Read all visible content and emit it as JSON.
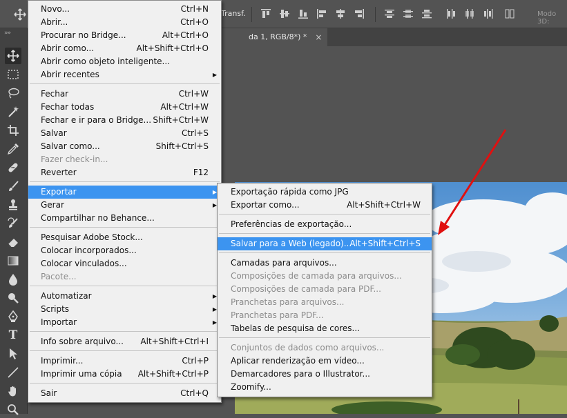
{
  "options_bar": {
    "transform_label": "Transf.",
    "mode_3d_label": "Modo 3D:"
  },
  "document_tab": {
    "title": "da 1, RGB/8*) *",
    "close_symbol": "×"
  },
  "toolbar": {
    "grip": "»»",
    "tools": [
      "move-icon",
      "marquee-icon",
      "lasso-icon",
      "magic-wand-icon",
      "crop-icon",
      "eyedropper-icon",
      "healing-icon",
      "brush-icon",
      "stamp-icon",
      "history-brush-icon",
      "eraser-icon",
      "gradient-icon",
      "blur-icon",
      "dodge-icon",
      "pen-icon",
      "type-icon",
      "path-selection-icon",
      "line-icon",
      "hand-icon",
      "zoom-icon"
    ],
    "type_glyph": "T"
  },
  "file_menu": {
    "items": [
      {
        "label": "Novo...",
        "shortcut": "Ctrl+N"
      },
      {
        "label": "Abrir...",
        "shortcut": "Ctrl+O"
      },
      {
        "label": "Procurar no Bridge...",
        "shortcut": "Alt+Ctrl+O"
      },
      {
        "label": "Abrir como...",
        "shortcut": "Alt+Shift+Ctrl+O"
      },
      {
        "label": "Abrir como objeto inteligente...",
        "shortcut": ""
      },
      {
        "label": "Abrir recentes",
        "submenu": true
      },
      {
        "label": "Fechar",
        "shortcut": "Ctrl+W"
      },
      {
        "label": "Fechar todas",
        "shortcut": "Alt+Ctrl+W"
      },
      {
        "label": "Fechar e ir para o Bridge...",
        "shortcut": "Shift+Ctrl+W"
      },
      {
        "label": "Salvar",
        "shortcut": "Ctrl+S"
      },
      {
        "label": "Salvar como...",
        "shortcut": "Shift+Ctrl+S"
      },
      {
        "label": "Fazer check-in...",
        "disabled": true
      },
      {
        "label": "Reverter",
        "shortcut": "F12"
      },
      {
        "label": "Exportar",
        "submenu": true,
        "highlighted": true
      },
      {
        "label": "Gerar",
        "submenu": true
      },
      {
        "label": "Compartilhar no Behance..."
      },
      {
        "label": "Pesquisar Adobe Stock..."
      },
      {
        "label": "Colocar incorporados..."
      },
      {
        "label": "Colocar vinculados..."
      },
      {
        "label": "Pacote...",
        "disabled": true
      },
      {
        "label": "Automatizar",
        "submenu": true
      },
      {
        "label": "Scripts",
        "submenu": true
      },
      {
        "label": "Importar",
        "submenu": true
      },
      {
        "label": "Info sobre arquivo...",
        "shortcut": "Alt+Shift+Ctrl+I"
      },
      {
        "label": "Imprimir...",
        "shortcut": "Ctrl+P"
      },
      {
        "label": "Imprimir uma cópia",
        "shortcut": "Alt+Shift+Ctrl+P"
      },
      {
        "label": "Sair",
        "shortcut": "Ctrl+Q"
      }
    ]
  },
  "export_submenu": {
    "items": [
      {
        "label": "Exportação rápida como JPG"
      },
      {
        "label": "Exportar como...",
        "shortcut": "Alt+Shift+Ctrl+W"
      },
      {
        "label": "Preferências de exportação..."
      },
      {
        "label": "Salvar para a Web (legado)...",
        "shortcut": "Alt+Shift+Ctrl+S",
        "highlighted": true
      },
      {
        "label": "Camadas para arquivos..."
      },
      {
        "label": "Composições de camada para arquivos...",
        "disabled": true
      },
      {
        "label": "Composições de camada para PDF...",
        "disabled": true
      },
      {
        "label": "Pranchetas para arquivos...",
        "disabled": true
      },
      {
        "label": "Pranchetas para PDF...",
        "disabled": true
      },
      {
        "label": "Tabelas de pesquisa de cores..."
      },
      {
        "label": "Conjuntos de dados como arquivos...",
        "disabled": true
      },
      {
        "label": "Aplicar renderização em vídeo..."
      },
      {
        "label": "Demarcadores para o Illustrator..."
      },
      {
        "label": "Zoomify..."
      }
    ]
  },
  "colors": {
    "menu_highlight": "#3c94f0",
    "annotation_arrow": "#e01010"
  }
}
